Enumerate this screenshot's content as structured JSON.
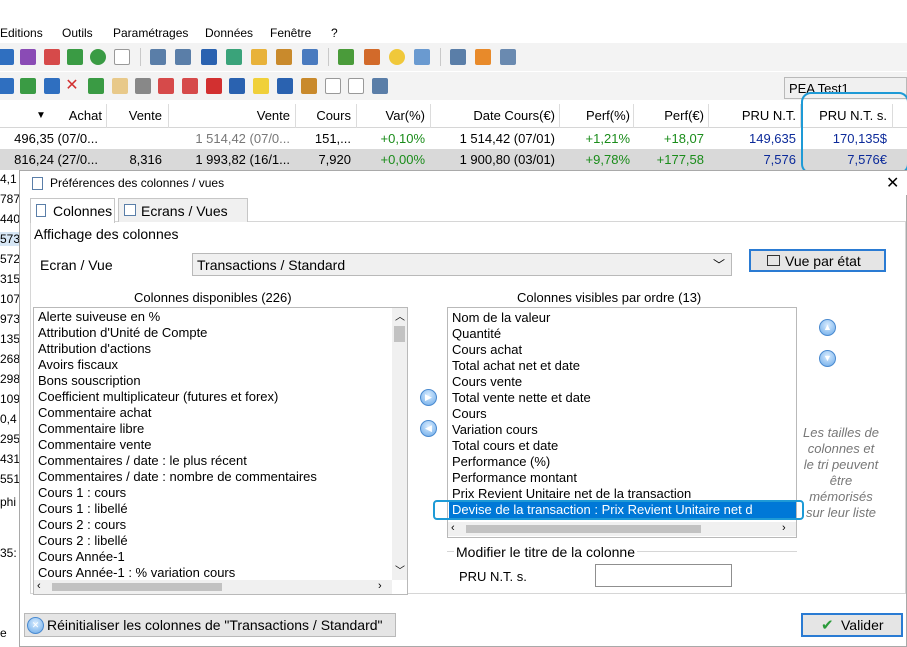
{
  "menu": [
    "Editions",
    "Outils",
    "Paramétrages",
    "Données",
    "Fenêtre",
    "?"
  ],
  "portfolio_select": "PEA Test1",
  "grid": {
    "headers": [
      "Achat",
      "Vente",
      "Vente",
      "Cours",
      "Var(%)",
      "Date Cours(€)",
      "Perf(%)",
      "Perf(€)",
      "PRU N.T.",
      "PRU N.T. s."
    ],
    "rows": [
      [
        "496,35 (07/0...",
        "",
        "1 514,42 (07/0...",
        "151,...",
        "+0,10%",
        "1 514,42 (07/01)",
        "+1,21%",
        "+18,07",
        "149,635",
        "170,135$"
      ],
      [
        "816,24 (27/0...",
        "8,316",
        "1 993,82 (16/1...",
        "7,920",
        "+0,00%",
        "1 900,80 (03/01)",
        "+9,78%",
        "+177,58",
        "7,576",
        "7,576€"
      ]
    ],
    "left_truncated": [
      "4,1",
      "787",
      "440",
      "573",
      "572",
      "315",
      "107",
      "973",
      "135",
      "268",
      "298",
      "109",
      "0,4",
      "295",
      "431",
      "551",
      "phi",
      "35:",
      "e"
    ]
  },
  "dialog": {
    "title": "Préférences des colonnes / vues",
    "tabs": [
      "Colonnes",
      "Ecrans / Vues"
    ],
    "group_label": "Affichage des colonnes",
    "ecran_label": "Ecran / Vue",
    "ecran_value": "Transactions / Standard",
    "vue_button": "Vue par état",
    "available_label": "Colonnes disponibles (226)",
    "available": [
      "Alerte suiveuse en %",
      "Attribution d'Unité de Compte",
      "Attribution d'actions",
      "Avoirs fiscaux",
      "Bons souscription",
      "Coefficient multiplicateur (futures et forex)",
      "Commentaire achat",
      "Commentaire libre",
      "Commentaire vente",
      "Commentaires / date : le plus récent",
      "Commentaires / date : nombre de commentaires",
      "Cours 1 : cours",
      "Cours 1 : libellé",
      "Cours 2 : cours",
      "Cours 2 : libellé",
      "Cours Année-1",
      "Cours Année-1 : % variation cours"
    ],
    "visible_label": "Colonnes visibles par ordre (13)",
    "visible": [
      "Nom de la valeur",
      "Quantité",
      "Cours achat",
      "Total achat net et date",
      "Cours vente",
      "Total vente nette et date",
      "Cours",
      "Variation cours",
      "Total cours et date",
      "Performance (%)",
      "Performance montant",
      "Prix Revient Unitaire net de la transaction",
      "Devise de la transaction : Prix Revient Unitaire net d"
    ],
    "note": "Les tailles de colonnes et le tri peuvent être mémorisés sur leur liste",
    "modify_label": "Modifier le titre de la colonne",
    "pru_label": "PRU N.T. s.",
    "pru_value": "",
    "reset_button": "Réinitialiser les colonnes de \"Transactions / Standard\"",
    "valider_button": "Valider"
  },
  "colors": {
    "selection": "#0078d7",
    "annotation": "#1e9ad6",
    "positive": "#1a8c1a",
    "pru_blue": "#0c2a9a"
  }
}
